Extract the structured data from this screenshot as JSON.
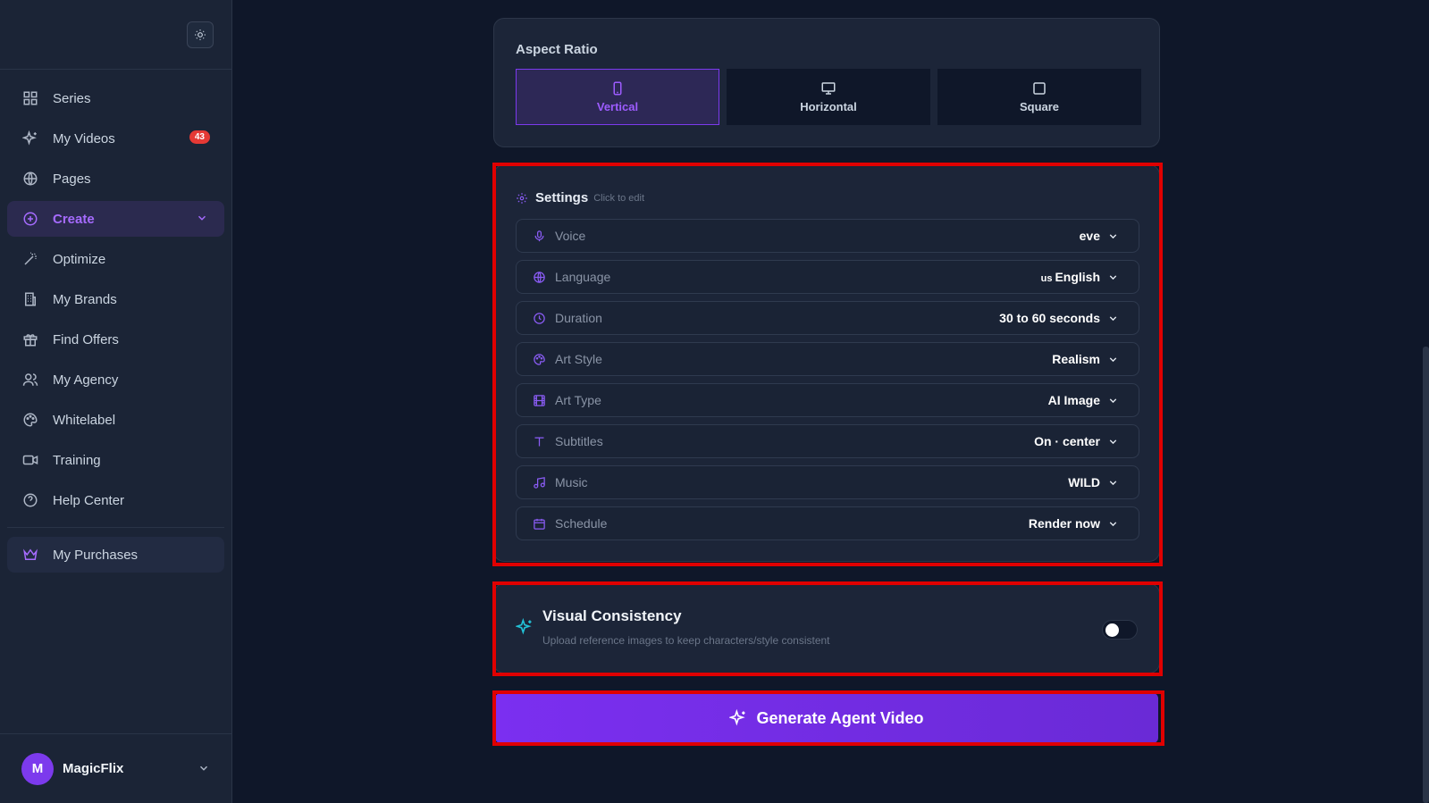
{
  "sidebar": {
    "items": [
      {
        "label": "Series",
        "icon": "grid-icon"
      },
      {
        "label": "My Videos",
        "icon": "sparkles-icon",
        "badge": "43"
      },
      {
        "label": "Pages",
        "icon": "globe-icon"
      },
      {
        "label": "Create",
        "icon": "plus-circle-icon"
      },
      {
        "label": "Optimize",
        "icon": "wand-icon"
      },
      {
        "label": "My Brands",
        "icon": "building-icon"
      },
      {
        "label": "Find Offers",
        "icon": "gift-icon"
      },
      {
        "label": "My Agency",
        "icon": "users-icon"
      },
      {
        "label": "Whitelabel",
        "icon": "palette-icon"
      },
      {
        "label": "Training",
        "icon": "video-icon"
      },
      {
        "label": "Help Center",
        "icon": "help-circle-icon"
      }
    ],
    "purchases": {
      "label": "My Purchases",
      "icon": "crown-icon"
    },
    "user": {
      "initial": "M",
      "name": "MagicFlix"
    }
  },
  "aspect": {
    "title": "Aspect Ratio",
    "options": [
      {
        "label": "Vertical",
        "selected": true
      },
      {
        "label": "Horizontal",
        "selected": false
      },
      {
        "label": "Square",
        "selected": false
      }
    ]
  },
  "settings": {
    "title": "Settings",
    "subtitle": "Click to edit",
    "rows": [
      {
        "label": "Voice",
        "value": "eve",
        "icon": "mic-icon"
      },
      {
        "label": "Language",
        "flag": "us",
        "value": "English",
        "icon": "globe-icon"
      },
      {
        "label": "Duration",
        "value": "30 to 60 seconds",
        "icon": "clock-icon"
      },
      {
        "label": "Art Style",
        "value": "Realism",
        "icon": "palette-icon"
      },
      {
        "label": "Art Type",
        "value": "AI Image",
        "icon": "film-icon"
      },
      {
        "label": "Subtitles",
        "value": "On · center",
        "icon": "type-icon"
      },
      {
        "label": "Music",
        "value": "WILD",
        "icon": "music-icon"
      },
      {
        "label": "Schedule",
        "value": "Render now",
        "icon": "calendar-icon"
      }
    ]
  },
  "visual": {
    "title": "Visual Consistency",
    "subtitle": "Upload reference images to keep characters/style consistent",
    "enabled": false
  },
  "generate": {
    "label": "Generate Agent Video"
  },
  "colors": {
    "accent": "#7c3aed",
    "highlight": "#e00000",
    "badge": "#e53935"
  }
}
